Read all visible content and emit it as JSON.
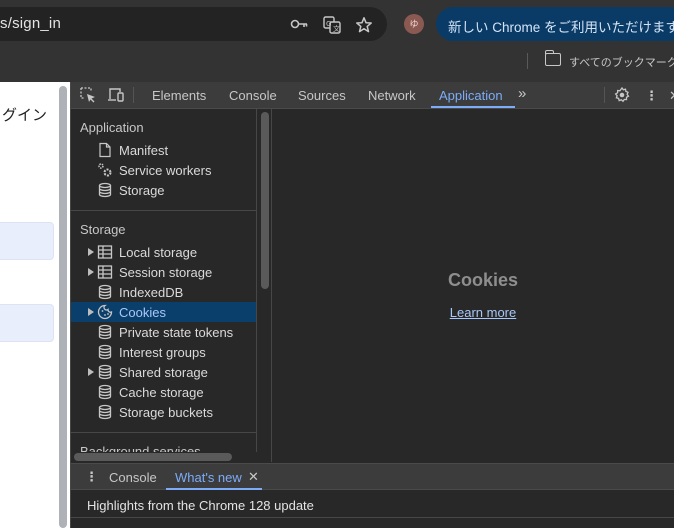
{
  "browser": {
    "url_visible": "s/sign_in",
    "omnibox_icons": [
      "key-icon",
      "translate-icon",
      "star-icon"
    ],
    "avatar_initial": "ゆ",
    "update_button_label": "新しい Chrome をご利用いただけます",
    "update_menu_glyph": "⋮",
    "bookmark_label": "すべてのブックマーク"
  },
  "page": {
    "heading_partial": "ログイン"
  },
  "devtools": {
    "toolbar": {
      "tabs": [
        {
          "label": "Elements",
          "active": false
        },
        {
          "label": "Console",
          "active": false
        },
        {
          "label": "Sources",
          "active": false
        },
        {
          "label": "Network",
          "active": false
        },
        {
          "label": "Application",
          "active": true
        }
      ],
      "more_tabs_glyph": "»",
      "menu_glyph": "⋮",
      "close_glyph": "✕"
    },
    "sidebar": {
      "sections": [
        {
          "title": "Application",
          "items": [
            {
              "label": "Manifest",
              "icon": "document-icon",
              "expandable": false
            },
            {
              "label": "Service workers",
              "icon": "gears-icon",
              "expandable": false
            },
            {
              "label": "Storage",
              "icon": "database-icon",
              "expandable": false
            }
          ]
        },
        {
          "title": "Storage",
          "items": [
            {
              "label": "Local storage",
              "icon": "table-icon",
              "expandable": true
            },
            {
              "label": "Session storage",
              "icon": "table-icon",
              "expandable": true
            },
            {
              "label": "IndexedDB",
              "icon": "database-icon",
              "expandable": false
            },
            {
              "label": "Cookies",
              "icon": "cookie-icon",
              "expandable": true,
              "selected": true
            },
            {
              "label": "Private state tokens",
              "icon": "database-icon",
              "expandable": false
            },
            {
              "label": "Interest groups",
              "icon": "database-icon",
              "expandable": false
            },
            {
              "label": "Shared storage",
              "icon": "database-icon",
              "expandable": true
            },
            {
              "label": "Cache storage",
              "icon": "database-icon",
              "expandable": false
            },
            {
              "label": "Storage buckets",
              "icon": "database-icon",
              "expandable": false
            }
          ]
        },
        {
          "title": "Background services",
          "items": []
        }
      ]
    },
    "main": {
      "title": "Cookies",
      "link_label": "Learn more"
    },
    "drawer": {
      "menu_glyph": "⋮",
      "tabs": [
        {
          "label": "Console",
          "active": false
        },
        {
          "label": "What's new",
          "active": true,
          "closable": true
        }
      ],
      "close_glyph": "✕",
      "headline": "Highlights from the Chrome 128 update"
    }
  },
  "colors": {
    "accent": "#7cacf8",
    "selected_row": "#0b3f6b",
    "update_pill": "#0a3b67"
  }
}
